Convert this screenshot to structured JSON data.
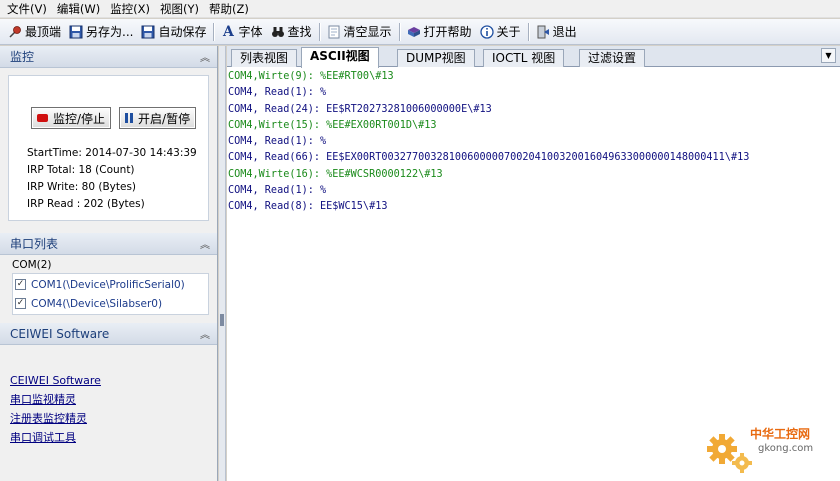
{
  "menu": [
    "文件(V)",
    "编辑(W)",
    "监控(X)",
    "视图(Y)",
    "帮助(Z)"
  ],
  "toolbar": {
    "top": "最顶端",
    "save_as": "另存为...",
    "auto_save": "自动保存",
    "font": "字体",
    "find": "查找",
    "clear": "清空显示",
    "help": "打开帮助",
    "about": "关于",
    "exit": "退出"
  },
  "monitor_panel": {
    "title": "监控",
    "monitor_button": "监控/停止",
    "pause_button": "开启/暂停",
    "start_time": "StartTime: 2014-07-30 14:43:39",
    "irp_total": "IRP Total: 18 (Count)",
    "irp_write": "IRP Write: 80 (Bytes)",
    "irp_read": "IRP Read : 202 (Bytes)"
  },
  "port_panel": {
    "title": "串口列表",
    "group": "COM(2)",
    "ports": [
      {
        "label": "COM1(\\Device\\ProlificSerial0)",
        "checked": true
      },
      {
        "label": "COM4(\\Device\\Silabser0)",
        "checked": true
      }
    ]
  },
  "software_panel": {
    "title": "CEIWEI Software",
    "links": [
      "CEIWEI Software",
      "串口监视精灵",
      "注册表监控精灵",
      "串口调试工具"
    ]
  },
  "tabs": [
    {
      "label": "列表视图",
      "active": false
    },
    {
      "label": "ASCII视图",
      "active": true
    },
    {
      "label": "DUMP视图",
      "active": false
    },
    {
      "label": "IOCTL 视图",
      "active": false
    },
    {
      "label": "过滤设置",
      "active": false
    }
  ],
  "log": [
    {
      "type": "write",
      "text": "COM4,Wirte(9): %EE#RT00\\#13"
    },
    {
      "type": "read",
      "text": "COM4, Read(1): %"
    },
    {
      "type": "read",
      "text": "COM4, Read(24): EE$RT20273281006000000E\\#13"
    },
    {
      "type": "write",
      "text": "COM4,Wirte(15): %EE#EX00RT001D\\#13"
    },
    {
      "type": "read",
      "text": "COM4, Read(1): %"
    },
    {
      "type": "read",
      "text": "COM4, Read(66): EE$EX00RT00327700328100600000700204100320016049633000000148000411\\#13"
    },
    {
      "type": "write",
      "text": "COM4,Wirte(16): %EE#WCSR0000122\\#13"
    },
    {
      "type": "read",
      "text": "COM4, Read(1): %"
    },
    {
      "type": "read",
      "text": "COM4, Read(8): EE$WC15\\#13"
    }
  ],
  "watermark": {
    "title": "中华工控网",
    "url": "gkong.com"
  },
  "colors": {
    "write": "#1a8a1a",
    "read": "#101080",
    "accent": "#1d3f7a"
  }
}
